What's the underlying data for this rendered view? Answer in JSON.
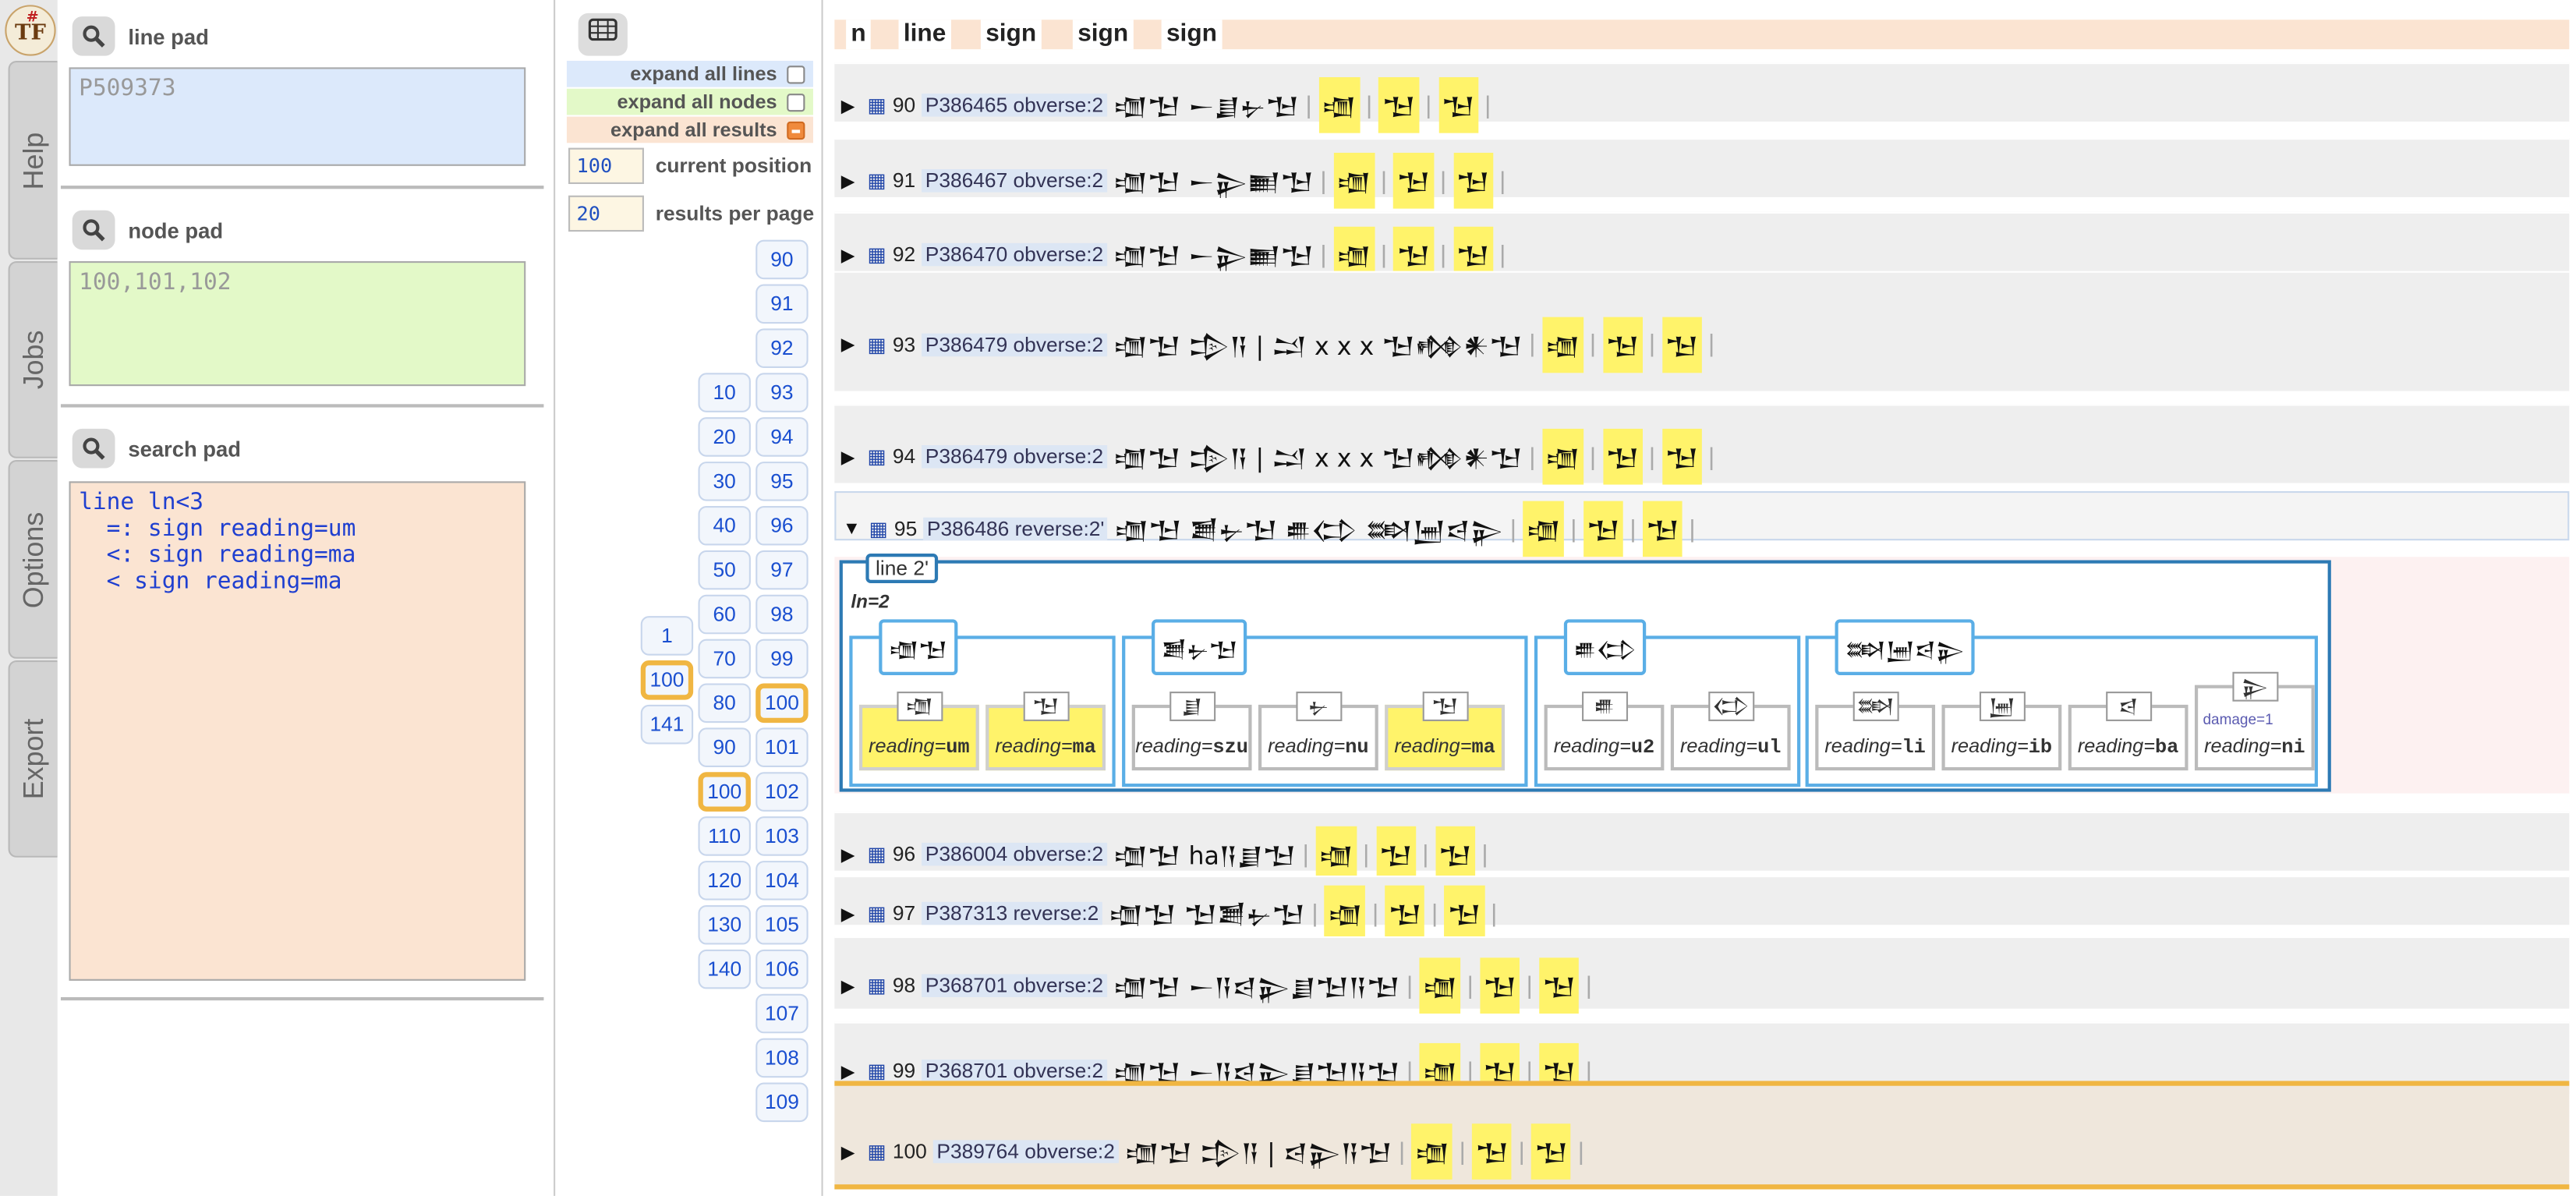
{
  "logo": "TF",
  "logo_mark": "#",
  "tabs": [
    "Help",
    "Jobs",
    "Options",
    "Export"
  ],
  "line_pad": {
    "label": "line pad",
    "value": "P509373"
  },
  "node_pad": {
    "label": "node pad",
    "value": "100,101,102"
  },
  "search_pad": {
    "label": "search pad",
    "value": "line ln<3\n  =: sign reading=um\n  <: sign reading=ma\n  < sign reading=ma"
  },
  "expand": {
    "lines": "expand all lines",
    "nodes": "expand all nodes",
    "results": "expand all results"
  },
  "current_position": {
    "value": "100",
    "label": "current position"
  },
  "results_per_page": {
    "value": "20",
    "label": "results per page"
  },
  "pages_col1": [
    "1",
    "100",
    "141"
  ],
  "pages_col2": [
    "10",
    "20",
    "30",
    "40",
    "50",
    "60",
    "70",
    "80",
    "90",
    "100",
    "110",
    "120",
    "130",
    "140"
  ],
  "pages_col3": [
    "90",
    "91",
    "92",
    "93",
    "94",
    "95",
    "96",
    "97",
    "98",
    "99",
    "100",
    "101",
    "102",
    "103",
    "104",
    "105",
    "106",
    "107",
    "108",
    "109"
  ],
  "columns": [
    "n",
    "line",
    "sign",
    "sign",
    "sign"
  ],
  "results": [
    {
      "n": "90",
      "id": "P386465 obverse:2",
      "line": "𒌝𒈠 𒀸𒋗𒉡𒈠",
      "s1": "𒌝",
      "s2": "𒈠",
      "s3": "𒈠"
    },
    {
      "n": "91",
      "id": "P386467 obverse:2",
      "line": "𒌝𒈠 𒀸𒉌𒆤𒈠",
      "s1": "𒌝",
      "s2": "𒈠",
      "s3": "𒈠"
    },
    {
      "n": "92",
      "id": "P386470 obverse:2",
      "line": "𒌝𒈠 𒀸𒉌𒆤𒈠",
      "s1": "𒌝",
      "s2": "𒈠",
      "s3": "𒈠"
    },
    {
      "n": "93",
      "id": "P386479 obverse:2",
      "line": "𒌝𒈠 𒄠𒀀 | 𒁺 x x x 𒈠𒂔𒀭𒈠",
      "s1": "𒌝",
      "s2": "𒈠",
      "s3": "𒈠"
    },
    {
      "n": "94",
      "id": "P386479 obverse:2",
      "line": "𒌝𒈠 𒄠𒀀 | 𒁺 x x x 𒈠𒂔𒀭𒈠",
      "s1": "𒌝",
      "s2": "𒈠",
      "s3": "𒈠"
    },
    {
      "n": "95",
      "id": "P386486 reverse:2'",
      "line": "𒌝𒈠 𒋢𒉡𒈠 𒌑𒌌 𒇷𒅁𒁀𒉌",
      "s1": "𒌝",
      "s2": "𒈠",
      "s3": "𒈠"
    },
    {
      "n": "96",
      "id": "P386004 obverse:2",
      "line": "𒌝𒈠 ha𒀀𒋗𒈠",
      "s1": "𒌝",
      "s2": "𒈠",
      "s3": "𒈠"
    },
    {
      "n": "97",
      "id": "P387313 reverse:2",
      "line": "𒌝𒈠 𒈠𒋢𒉡𒈠",
      "s1": "𒌝",
      "s2": "𒈠",
      "s3": "𒈠"
    },
    {
      "n": "98",
      "id": "P368701 obverse:2",
      "line": "𒌝𒈠 𒀸𒀀𒁀𒉌𒋗𒈠𒀀𒈠",
      "s1": "𒌝",
      "s2": "𒈠",
      "s3": "𒈠"
    },
    {
      "n": "99",
      "id": "P368701 obverse:2",
      "line": "𒌝𒈠 𒀸𒀀𒁀𒉌𒋗𒈠𒀀𒈠",
      "s1": "𒌝",
      "s2": "𒈠",
      "s3": "𒈠"
    },
    {
      "n": "100",
      "id": "P389764 obverse:2",
      "line": "𒌝𒈠 𒄠𒀀 | 𒁀𒉌𒀀𒈠",
      "s1": "𒌝",
      "s2": "𒈠",
      "s3": "𒈠"
    }
  ],
  "expanded": {
    "line_label": "line 2'",
    "ln": "ln=2",
    "words": [
      {
        "glyph": "𒌝𒈠",
        "signs": [
          {
            "r": "um",
            "g": "𒌝"
          },
          {
            "r": "ma",
            "g": "𒈠"
          }
        ]
      },
      {
        "glyph": "𒋢𒉡𒈠",
        "signs": [
          {
            "r": "szu",
            "g": "𒋗"
          },
          {
            "r": "nu",
            "g": "𒉡"
          },
          {
            "r": "ma",
            "g": "𒈠"
          }
        ]
      },
      {
        "glyph": "𒌑𒌌",
        "signs": [
          {
            "r": "u2",
            "g": "𒌑"
          },
          {
            "r": "ul",
            "g": "𒌌"
          }
        ]
      },
      {
        "glyph": "𒇷𒅁𒁀𒉌",
        "signs": [
          {
            "r": "li",
            "g": "𒇷"
          },
          {
            "r": "ib",
            "g": "𒅁"
          },
          {
            "r": "ba",
            "g": "𒁀"
          },
          {
            "r": "ni",
            "g": "𒉌"
          }
        ]
      }
    ],
    "reading_prefix": "reading=",
    "damage": "damage=1"
  }
}
